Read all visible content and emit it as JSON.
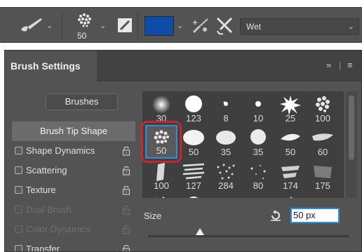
{
  "toolbar": {
    "brush_size": "50",
    "foreground_color": "#0d4da8",
    "mode_value": "Wet"
  },
  "panel": {
    "title": "Brush Settings",
    "menu_chevrons": "»",
    "brushes_button": "Brushes",
    "side_items": [
      {
        "label": "Brush Tip Shape",
        "selected": true
      },
      {
        "label": "Shape Dynamics",
        "checked": false,
        "locked": true
      },
      {
        "label": "Scattering",
        "checked": false,
        "locked": true
      },
      {
        "label": "Texture",
        "checked": false,
        "locked": true
      },
      {
        "label": "Dual Brush",
        "checked": false,
        "locked": true,
        "disabled": true
      },
      {
        "label": "Color Dynamics",
        "checked": false,
        "locked": true,
        "disabled": true
      },
      {
        "label": "Transfer",
        "checked": false,
        "locked": true
      }
    ],
    "presets": [
      [
        "30",
        "123",
        "8",
        "10",
        "25",
        "100"
      ],
      [
        "50",
        "50",
        "35",
        "35",
        "50",
        "60"
      ],
      [
        "100",
        "127",
        "284",
        "80",
        "174",
        "175"
      ]
    ],
    "selected_preset": "50",
    "size_label": "Size",
    "size_value": "50 px",
    "size_slider_fraction": 0.26
  },
  "colors": {
    "accent": "#2f8fd8",
    "highlight": "#c7262f"
  }
}
